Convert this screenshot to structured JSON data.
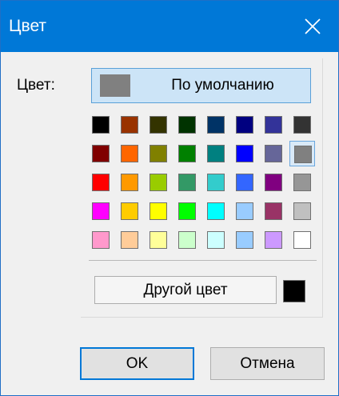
{
  "window": {
    "title": "Цвет",
    "close_icon": "close-icon"
  },
  "color_label": "Цвет:",
  "default_button": {
    "label": "По умолчанию",
    "swatch_color": "#808080"
  },
  "palette": [
    [
      "#000000",
      "#993300",
      "#333300",
      "#003300",
      "#003366",
      "#000080",
      "#333399",
      "#333333"
    ],
    [
      "#800000",
      "#FF6600",
      "#808000",
      "#008000",
      "#008080",
      "#0000FF",
      "#666699",
      "#808080"
    ],
    [
      "#FF0000",
      "#FF9900",
      "#99CC00",
      "#339966",
      "#33CCCC",
      "#3366FF",
      "#800080",
      "#969696"
    ],
    [
      "#FF00FF",
      "#FFCC00",
      "#FFFF00",
      "#00FF00",
      "#00FFFF",
      "#99CCFF",
      "#993366",
      "#C0C0C0"
    ],
    [
      "#FF99CC",
      "#FFCC99",
      "#FFFF99",
      "#CCFFCC",
      "#CCFFFF",
      "#99CCFF",
      "#CC99FF",
      "#FFFFFF"
    ]
  ],
  "selected_swatch": "#808080",
  "other_color_button": {
    "label": "Другой цвет"
  },
  "current_color": "#000000",
  "buttons": {
    "ok": "OK",
    "cancel": "Отмена"
  }
}
